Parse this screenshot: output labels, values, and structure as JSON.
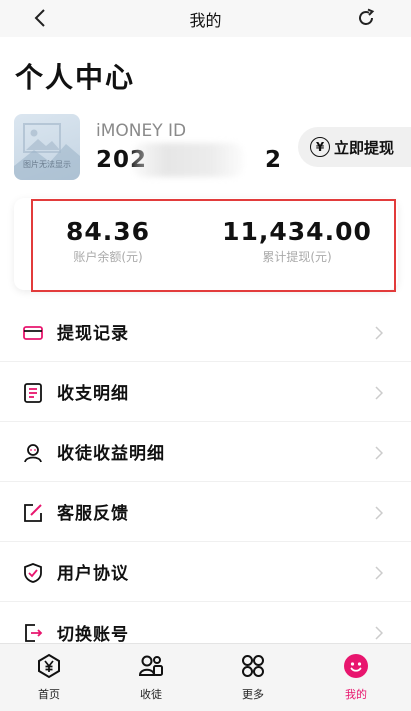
{
  "header": {
    "title": "我的"
  },
  "page_title": "个人中心",
  "profile": {
    "avatar_watermark": "图片无法显示",
    "id_label": "iMONEY ID",
    "id_value": "202",
    "id_value_suffix": "2"
  },
  "withdraw_button": {
    "label": "立即提现",
    "icon": "yen-circle-icon"
  },
  "stats": {
    "balance": {
      "value": "84.36",
      "caption": "账户余额(元)"
    },
    "total_withdrawn": {
      "value": "11,434.00",
      "caption": "累计提现(元)"
    }
  },
  "menu": [
    {
      "label": "提现记录",
      "icon": "card-icon"
    },
    {
      "label": "收支明细",
      "icon": "ledger-icon"
    },
    {
      "label": "收徒收益明细",
      "icon": "user-icon"
    },
    {
      "label": "客服反馈",
      "icon": "edit-icon"
    },
    {
      "label": "用户协议",
      "icon": "shield-icon"
    },
    {
      "label": "切换账号",
      "icon": "switch-icon"
    }
  ],
  "tabs": [
    {
      "label": "首页",
      "icon": "home-yen-icon"
    },
    {
      "label": "收徒",
      "icon": "team-icon"
    },
    {
      "label": "更多",
      "icon": "grid-icon"
    },
    {
      "label": "我的",
      "icon": "me-icon",
      "active": true
    }
  ],
  "colors": {
    "accent": "#e8166e",
    "highlight_border": "#e23b3b"
  }
}
